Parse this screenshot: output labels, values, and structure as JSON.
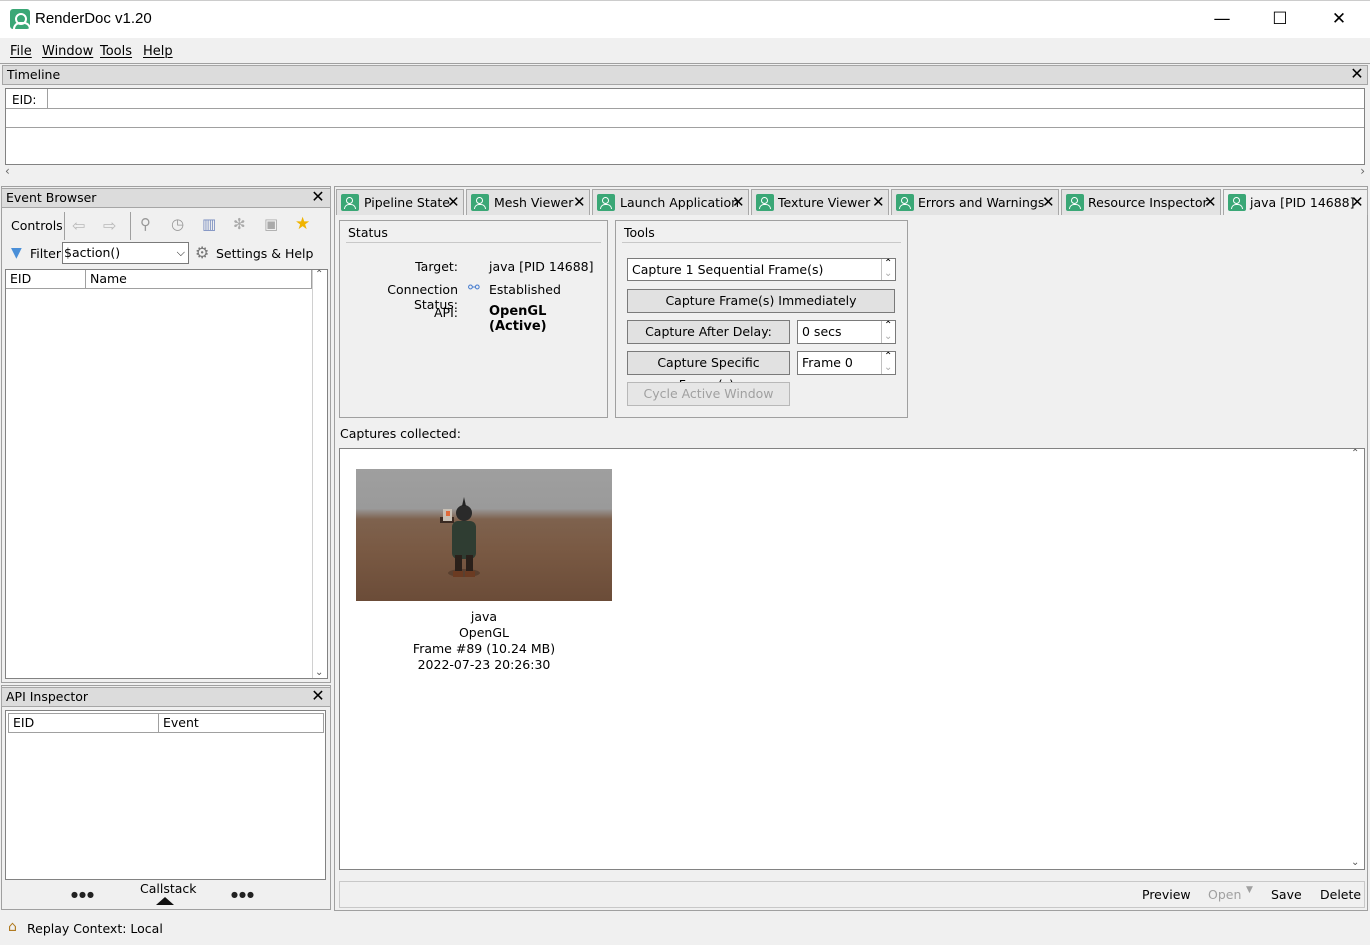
{
  "window": {
    "title": "RenderDoc v1.20",
    "min": "—",
    "max": "☐",
    "close": "✕"
  },
  "menu": [
    {
      "label": "File"
    },
    {
      "label": "Window"
    },
    {
      "label": "Tools"
    },
    {
      "label": "Help"
    }
  ],
  "timeline": {
    "title": "Timeline",
    "eid_label": "EID:"
  },
  "event_browser": {
    "title": "Event Browser",
    "controls_label": "Controls",
    "filter_label": "Filter",
    "filter_value": "$action()",
    "settings_label": "Settings & Help",
    "columns": [
      "EID",
      "Name"
    ]
  },
  "api_inspector": {
    "title": "API Inspector",
    "columns": [
      "EID",
      "Event"
    ],
    "callstack_label": "Callstack",
    "dots": "●●●"
  },
  "tabs": [
    {
      "label": "Pipeline State"
    },
    {
      "label": "Mesh Viewer"
    },
    {
      "label": "Launch Application"
    },
    {
      "label": "Texture Viewer"
    },
    {
      "label": "Errors and Warnings"
    },
    {
      "label": "Resource Inspector"
    },
    {
      "label": "java [PID 14688]"
    }
  ],
  "status": {
    "title": "Status",
    "target_label": "Target:",
    "target_value": "java [PID 14688]",
    "conn_label": "Connection Status:",
    "conn_value": "Established",
    "api_label": "API:",
    "api_value": "OpenGL (Active)"
  },
  "tools": {
    "title": "Tools",
    "frames_value": "Capture 1 Sequential Frame(s)",
    "capture_now": "Capture Frame(s) Immediately",
    "capture_delay": "Capture After Delay:",
    "delay_value": "0 secs",
    "capture_specific": "Capture Specific Frame(s):",
    "frame_value": "Frame 0",
    "cycle_window": "Cycle Active Window"
  },
  "captures": {
    "label": "Captures collected:",
    "items": [
      {
        "name": "java",
        "api": "OpenGL",
        "frame": "Frame #89 (10.24 MB)",
        "timestamp": "2022-07-23 20:26:30"
      }
    ]
  },
  "bottom_buttons": {
    "preview": "Preview",
    "open": "Open",
    "save": "Save",
    "delete": "Delete"
  },
  "statusbar": {
    "text": "Replay Context: Local"
  }
}
